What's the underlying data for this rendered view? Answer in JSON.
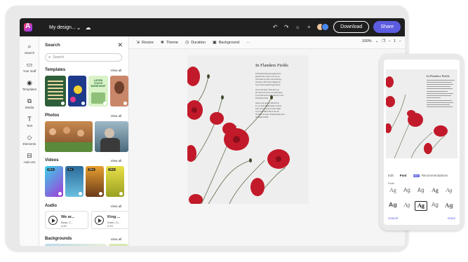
{
  "topbar": {
    "doc_title": "My design...",
    "download_label": "Download",
    "share_label": "Share",
    "icons": [
      "undo-icon",
      "redo-icon",
      "lightbulb-icon",
      "collaborators-avatars"
    ]
  },
  "rail": {
    "items": [
      {
        "label": "Search",
        "icon": "search-icon",
        "glyph": "⌕"
      },
      {
        "label": "Your stuff",
        "icon": "folder-icon",
        "glyph": "▭"
      },
      {
        "label": "Templates",
        "icon": "templates-icon",
        "glyph": "◉"
      },
      {
        "label": "Media",
        "icon": "media-icon",
        "glyph": "⧉"
      },
      {
        "label": "Text",
        "icon": "text-icon",
        "glyph": "T"
      },
      {
        "label": "Elements",
        "icon": "elements-icon",
        "glyph": "◇"
      },
      {
        "label": "Add-ons",
        "icon": "addons-icon",
        "glyph": "⊟"
      }
    ]
  },
  "panel": {
    "title": "Search",
    "search_placeholder": "Search",
    "sections": {
      "templates": {
        "title": "Templates",
        "view_all": "View all"
      },
      "photos": {
        "title": "Photos",
        "view_all": "View all"
      },
      "videos": {
        "title": "Videos",
        "view_all": "View all"
      },
      "audio": {
        "title": "Audio",
        "view_all": "View all"
      },
      "backgrounds": {
        "title": "Backgrounds",
        "view_all": "View all"
      }
    },
    "template_texts": [
      "LISTEN YOUTH WORKSHOP"
    ],
    "video_durations": [
      "20 s",
      "9 s",
      "25 s",
      "10 s"
    ],
    "audio": [
      {
        "title": "We ar...",
        "artist": "Blaia, C...",
        "time": "4:20"
      },
      {
        "title": "King ...",
        "artist": "Earth, Cl...",
        "time": "2:15"
      }
    ]
  },
  "canvas_toolbar": {
    "tools": [
      {
        "label": "Resize",
        "icon": "resize-icon",
        "glyph": "⇲"
      },
      {
        "label": "Theme",
        "icon": "theme-icon",
        "glyph": "❀"
      },
      {
        "label": "Duration",
        "icon": "duration-icon",
        "glyph": "◷"
      },
      {
        "label": "Background",
        "icon": "background-icon",
        "glyph": "▣"
      }
    ],
    "more": "···",
    "zoom": "100%",
    "page_number": "1"
  },
  "artboard": {
    "title": "In Flanders Fields",
    "stanzas": [
      "In Flanders fields the poppies blow\nBetween the crosses, row on row,\nThat mark our place; and in the sky\nThe larks, still bravely singing, fly\nScarce heard amid the guns below.",
      "We are the Dead. Short days ago\nWe lived, felt dawn, saw sunset glow,\nLoved and were loved, and now we lie\nIn Flanders fields.",
      "Take up our quarrel with the foe:\nTo you from failing hands we throw\nThe torch; be yours to hold it high.\nIf ye break faith with us who die\nWe shall not sleep, though poppies grow\nIn Flanders fields."
    ]
  },
  "phone": {
    "title": "In Flanders Fields",
    "tabs": {
      "edit": "Edit",
      "font": "Font",
      "badge": "NEW",
      "recommendations": "Recommendations"
    },
    "fonts_heading": "Fonts",
    "sample": "Ag",
    "cancel": "Cancel",
    "done": "Done"
  }
}
